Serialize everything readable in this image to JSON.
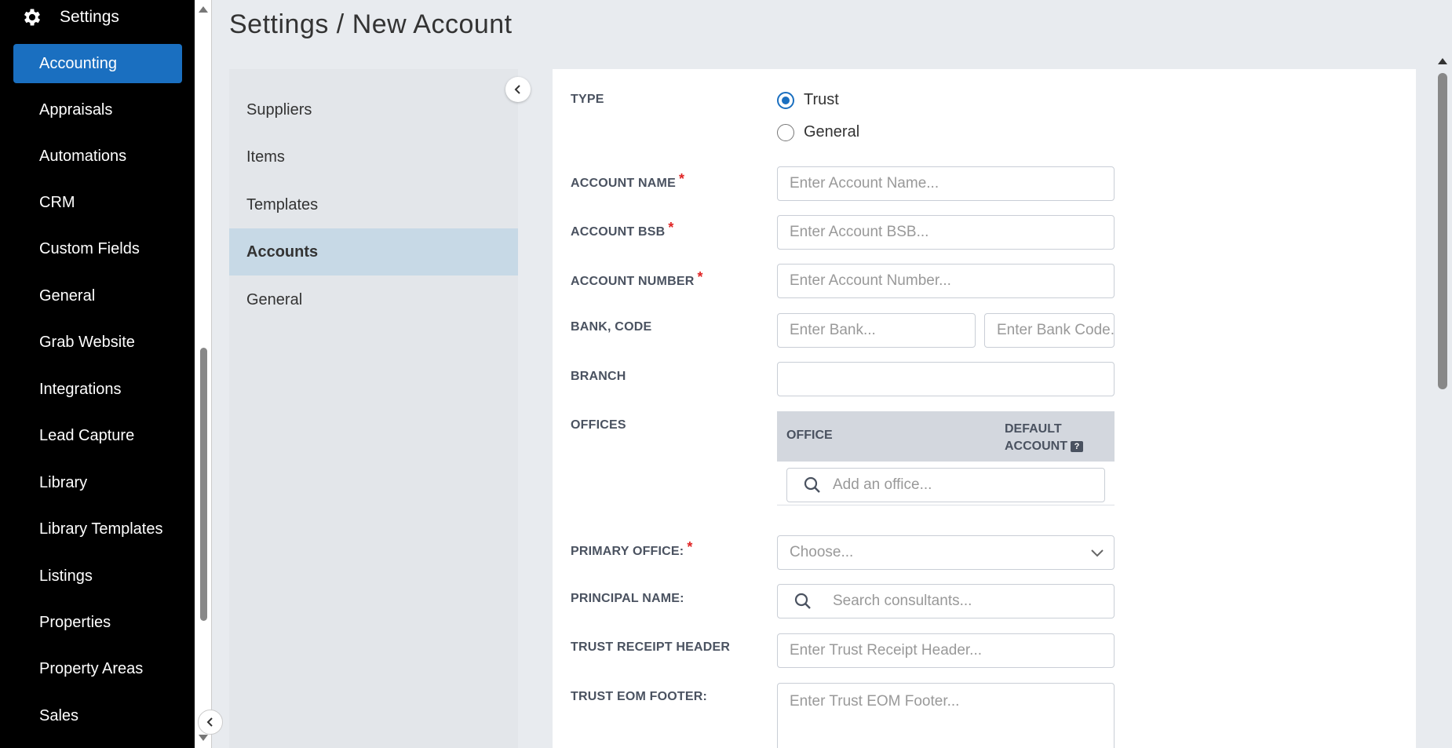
{
  "sidebar": {
    "header": {
      "icon": "gear-icon",
      "title": "Settings"
    },
    "items": [
      {
        "label": "Accounting",
        "active": true
      },
      {
        "label": "Appraisals"
      },
      {
        "label": "Automations"
      },
      {
        "label": "CRM"
      },
      {
        "label": "Custom Fields"
      },
      {
        "label": "General"
      },
      {
        "label": "Grab Website"
      },
      {
        "label": "Integrations"
      },
      {
        "label": "Lead Capture"
      },
      {
        "label": "Library"
      },
      {
        "label": "Library Templates"
      },
      {
        "label": "Listings"
      },
      {
        "label": "Properties"
      },
      {
        "label": "Property Areas"
      },
      {
        "label": "Sales"
      }
    ]
  },
  "page": {
    "title": "Settings / New Account"
  },
  "subnav": {
    "items": [
      {
        "label": "Suppliers"
      },
      {
        "label": "Items"
      },
      {
        "label": "Templates"
      },
      {
        "label": "Accounts",
        "active": true
      },
      {
        "label": "General"
      }
    ]
  },
  "form": {
    "type": {
      "label": "TYPE",
      "options": [
        "Trust",
        "General"
      ],
      "selected": "Trust"
    },
    "account_name": {
      "label": "ACCOUNT NAME",
      "required": "*",
      "placeholder": "Enter Account Name..."
    },
    "account_bsb": {
      "label": "ACCOUNT BSB",
      "required": "*",
      "placeholder": "Enter Account BSB..."
    },
    "account_number": {
      "label": "ACCOUNT NUMBER",
      "required": "*",
      "placeholder": "Enter Account Number..."
    },
    "bank_code": {
      "label": "BANK, CODE",
      "bank_placeholder": "Enter Bank...",
      "code_placeholder": "Enter Bank Code..."
    },
    "branch": {
      "label": "BRANCH",
      "value": ""
    },
    "offices": {
      "label": "OFFICES",
      "col_office": "OFFICE",
      "col_default_line1": "DEFAULT",
      "col_default_line2": "ACCOUNT",
      "help_glyph": "?",
      "search_placeholder": "Add an office..."
    },
    "primary_office": {
      "label": "PRIMARY OFFICE:",
      "required": "*",
      "placeholder": "Choose..."
    },
    "principal_name": {
      "label": "PRINCIPAL NAME:",
      "placeholder": "Search consultants..."
    },
    "trust_receipt_header": {
      "label": "TRUST RECEIPT HEADER",
      "placeholder": "Enter Trust Receipt Header..."
    },
    "trust_eom_footer": {
      "label": "TRUST EOM FOOTER:",
      "placeholder": "Enter Trust EOM Footer..."
    }
  },
  "colors": {
    "accent": "#1a6fc0",
    "required": "#e02424",
    "sidebar_bg": "#000000",
    "subnav_active": "#c7d9e6"
  }
}
